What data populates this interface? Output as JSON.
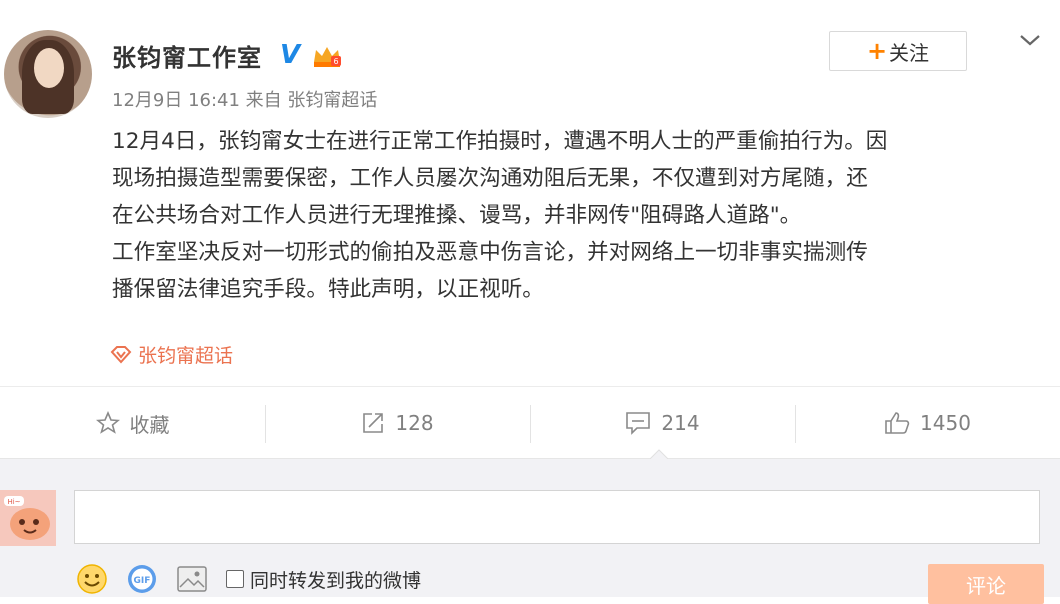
{
  "post": {
    "author": "张钧甯工作室",
    "follow_plus": "+",
    "follow_label": "关注",
    "meta": "12月9日 16:41 来自 张钧甯超话",
    "content": [
      "12月4日，张钧甯女士在进行正常工作拍摄时，遭遇不明人士的严重偷拍行为。因",
      "现场拍摄造型需要保密，工作人员屡次沟通劝阻后无果，不仅遭到对方尾随，还",
      "在公共场合对工作人员进行无理推搡、谩骂，并非网传\"阻碍路人道路\"。",
      "工作室坚决反对一切形式的偷拍及恶意中伤言论，并对网络上一切非事实揣测传",
      "播保留法律追究手段。特此声明，以正视听。"
    ],
    "topic": "张钧甯超话"
  },
  "actions": {
    "favorite": "收藏",
    "forward": "128",
    "comment": "214",
    "like": "1450"
  },
  "composer": {
    "placeholder": "",
    "forward_checkbox": "同时转发到我的微博",
    "submit": "评论"
  },
  "colors": {
    "accent": "#ff8200",
    "topic": "#eb7350",
    "verified": "#1e88e5",
    "submit_bg": "#ffc09f"
  }
}
